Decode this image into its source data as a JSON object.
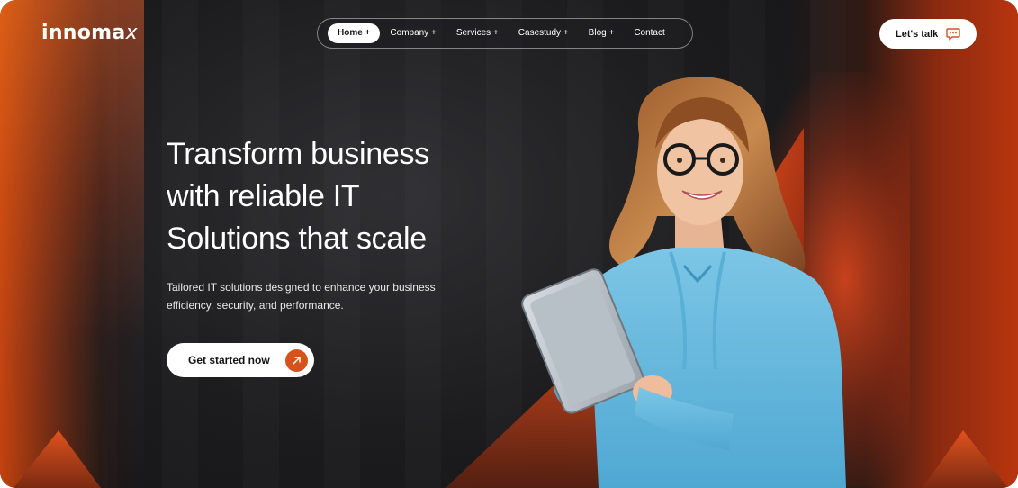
{
  "brand": {
    "name": "innoma",
    "suffix": "x"
  },
  "nav": {
    "items": [
      {
        "label": "Home +",
        "active": true
      },
      {
        "label": "Company +",
        "active": false
      },
      {
        "label": "Services +",
        "active": false
      },
      {
        "label": "Casestudy +",
        "active": false
      },
      {
        "label": "Blog +",
        "active": false
      },
      {
        "label": "Contact",
        "active": false
      }
    ]
  },
  "header": {
    "talk_label": "Let's talk",
    "talk_icon": "chat-bubble-icon"
  },
  "hero": {
    "headline_lines": [
      "Transform business",
      "with reliable IT",
      "Solutions that scale"
    ],
    "subtext_lines": [
      "Tailored IT solutions designed to enhance your business",
      "efficiency, security, and performance."
    ],
    "cta_label": "Get started now",
    "cta_icon": "arrow-up-right-icon"
  },
  "colors": {
    "accent": "#d4521c",
    "background": "#1d1d1f",
    "text": "#ffffff"
  }
}
